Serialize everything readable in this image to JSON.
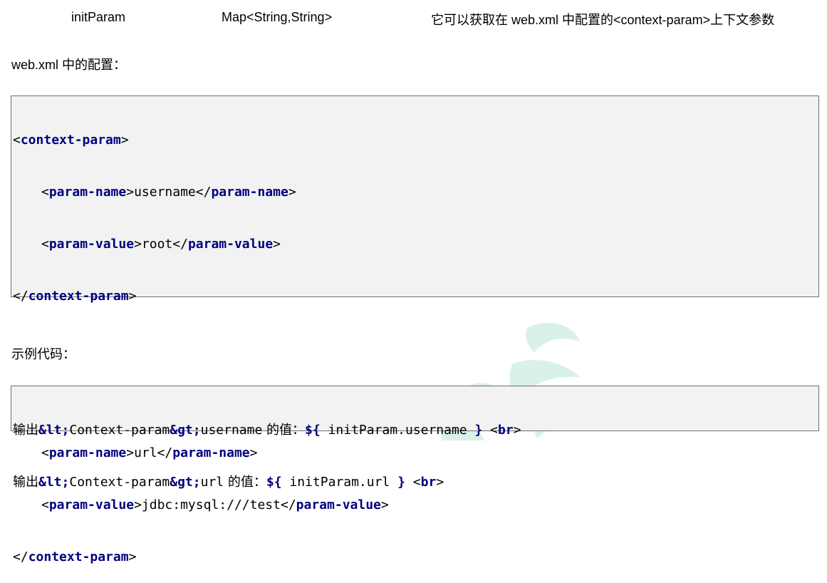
{
  "table_row": {
    "name": "initParam",
    "type": "Map<String,String>",
    "desc": "它可以获取在 web.xml 中配置的<context-param>上下文参数"
  },
  "web_xml_heading": "web.xml 中的配置：",
  "xml_block": {
    "lt": "<",
    "gt": ">",
    "lt_slash": "</",
    "tag_context": "context-param",
    "tag_name": "param-name",
    "tag_value": "param-value",
    "param1_name": "username",
    "param1_value": "root",
    "param2_name": "url",
    "param2_value": "jdbc:mysql:///test"
  },
  "example_heading": "示例代码：",
  "code_block": {
    "prefix": "输出",
    "ent_lt": "&lt;",
    "ent_gt": "&gt;",
    "mid": "Context-param",
    "line1_key": "username",
    "line2_key": "url",
    "value_label": " 的值：",
    "el_open": "${",
    "el_close": "}",
    "line1_expr": " initParam.username ",
    "line2_expr": " initParam.url ",
    "br_tag": "br"
  },
  "colors": {
    "keyword": "#000080",
    "code_bg": "#f2f2f2",
    "code_border": "#6f6f6f",
    "watermark": "#cfeee4"
  }
}
